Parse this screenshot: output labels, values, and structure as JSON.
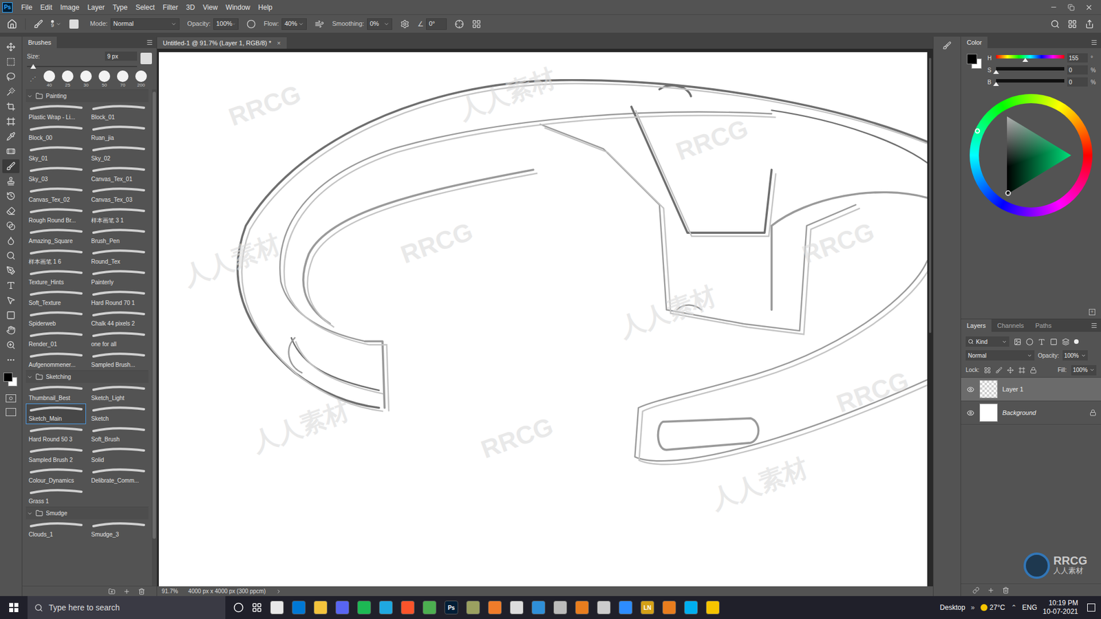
{
  "app_logo": "Ps",
  "menu": [
    "File",
    "Edit",
    "Image",
    "Layer",
    "Type",
    "Select",
    "Filter",
    "3D",
    "View",
    "Window",
    "Help"
  ],
  "options": {
    "brush_size": "9",
    "mode_label": "Mode:",
    "mode": "Normal",
    "opacity_label": "Opacity:",
    "opacity": "100%",
    "flow_label": "Flow:",
    "flow": "40%",
    "smoothing_label": "Smoothing:",
    "smoothing": "0%",
    "angle": "0°"
  },
  "document_tab": {
    "title": "Untitled-1 @ 91.7% (Layer 1, RGB/8) *",
    "close": "×"
  },
  "tools": [
    {
      "selected": false
    },
    {
      "selected": false
    },
    {
      "selected": false
    },
    {
      "selected": false
    },
    {
      "selected": false
    },
    {
      "selected": false
    },
    {
      "selected": false
    },
    {
      "selected": false
    },
    {
      "selected": true
    },
    {
      "selected": false
    },
    {
      "selected": false
    },
    {
      "selected": false
    },
    {
      "selected": false
    },
    {
      "selected": false
    },
    {
      "selected": false
    },
    {
      "selected": false
    },
    {
      "selected": false
    },
    {
      "selected": false
    },
    {
      "selected": false
    },
    {
      "selected": false
    },
    {
      "selected": false
    },
    {
      "selected": false
    }
  ],
  "brushes": {
    "title": "Brushes",
    "size_label": "Size:",
    "size": "9 px",
    "size_level": 0.03,
    "presets": [
      "40",
      "25",
      "30",
      "50",
      "70",
      "200"
    ],
    "groups": [
      {
        "name": "Painting",
        "expanded": true,
        "items": [
          {
            "label": "Plastic Wrap - Li...",
            "selected": false
          },
          {
            "label": "Block_01",
            "selected": false
          },
          {
            "label": "Block_00",
            "selected": false
          },
          {
            "label": "Ruan_jia",
            "selected": false
          },
          {
            "label": "Sky_01",
            "selected": false
          },
          {
            "label": "Sky_02",
            "selected": false
          },
          {
            "label": "Sky_03",
            "selected": false
          },
          {
            "label": "Canvas_Tex_01",
            "selected": false
          },
          {
            "label": "Canvas_Tex_02",
            "selected": false
          },
          {
            "label": "Canvas_Tex_03",
            "selected": false
          },
          {
            "label": "Rough Round Br...",
            "selected": false
          },
          {
            "label": "样本画笔 3 1",
            "selected": false
          },
          {
            "label": "Amazing_Square",
            "selected": false
          },
          {
            "label": "Brush_Pen",
            "selected": false
          },
          {
            "label": "样本画笔 1 6",
            "selected": false
          },
          {
            "label": "Round_Tex",
            "selected": false
          },
          {
            "label": "Texture_Hints",
            "selected": false
          },
          {
            "label": "Painterly",
            "selected": false
          },
          {
            "label": "Soft_Texture",
            "selected": false
          },
          {
            "label": "Hard Round 70 1",
            "selected": false
          },
          {
            "label": "Spiderweb",
            "selected": false
          },
          {
            "label": "Chalk 44 pixels 2",
            "selected": false
          },
          {
            "label": "Render_01",
            "selected": false
          },
          {
            "label": "one for all",
            "selected": false
          },
          {
            "label": "Aufgenommener...",
            "selected": false
          },
          {
            "label": "Sampled Brush...",
            "selected": false
          }
        ]
      },
      {
        "name": "Sketching",
        "expanded": true,
        "items": [
          {
            "label": "Thumbnail_Best",
            "selected": false
          },
          {
            "label": "Sketch_Light",
            "selected": false
          },
          {
            "label": "Sketch_Main",
            "selected": true
          },
          {
            "label": "Sketch",
            "selected": false
          },
          {
            "label": "Hard Round 50 3",
            "selected": false
          },
          {
            "label": "Soft_Brush",
            "selected": false
          },
          {
            "label": "Sampled Brush 2",
            "selected": false
          },
          {
            "label": "Solid",
            "selected": false
          },
          {
            "label": "Colour_Dynamics",
            "selected": false
          },
          {
            "label": "Delibrate_Comm...",
            "selected": false
          },
          {
            "label": "Grass 1",
            "selected": false
          }
        ]
      },
      {
        "name": "Smudge",
        "expanded": true,
        "items": [
          {
            "label": "Clouds_1",
            "selected": false
          },
          {
            "label": "Smudge_3",
            "selected": false
          }
        ]
      }
    ]
  },
  "status_bar": {
    "zoom": "91.7%",
    "doc_size": "4000 px x 4000 px (300 ppcm)"
  },
  "color": {
    "title": "Color",
    "foreground": "#000000",
    "background": "#ffffff",
    "channels": [
      {
        "label": "H",
        "value": "155",
        "unit": "°",
        "level": 0.43,
        "kind": "hue"
      },
      {
        "label": "S",
        "value": "0",
        "unit": "%",
        "level": 0,
        "kind": "plain"
      },
      {
        "label": "B",
        "value": "0",
        "unit": "%",
        "level": 0,
        "kind": "plain"
      }
    ]
  },
  "layers": {
    "tabs": [
      {
        "label": "Layers",
        "selected": true
      },
      {
        "label": "Channels",
        "selected": false
      },
      {
        "label": "Paths",
        "selected": false
      }
    ],
    "filter": "Kind",
    "blend_mode": "Normal",
    "opacity_label": "Opacity:",
    "opacity": "100%",
    "lock_label": "Lock:",
    "fill_label": "Fill:",
    "fill": "100%",
    "items": [
      {
        "name": "Layer 1",
        "selected": true,
        "visible": true,
        "locked": false,
        "italic": false,
        "kind": "transparent"
      },
      {
        "name": "Background",
        "selected": false,
        "visible": true,
        "locked": true,
        "italic": true,
        "kind": "white"
      }
    ]
  },
  "taskbar": {
    "search_placeholder": "Type here to search",
    "desktop": "Desktop",
    "chevron": "»",
    "weather": "27°C",
    "language": "ENG",
    "time": "10:19 PM",
    "date": "10-07-2021",
    "apps": [
      {
        "label": "",
        "color": "#e8e8e8"
      },
      {
        "label": "",
        "color": "#0078d4"
      },
      {
        "label": "",
        "color": "#f3c33c"
      },
      {
        "label": "",
        "color": "#5865f2"
      },
      {
        "label": "",
        "color": "#1db954"
      },
      {
        "label": "",
        "color": "#1fa8e0"
      },
      {
        "label": "",
        "color": "#fb542b"
      },
      {
        "label": "",
        "color": "#4caf50"
      },
      {
        "label": "Ps",
        "color": "#001e36"
      },
      {
        "label": "",
        "color": "#9aa060"
      },
      {
        "label": "",
        "color": "#f07c2a"
      },
      {
        "label": "",
        "color": "#dddddd"
      },
      {
        "label": "",
        "color": "#2f8fd8"
      },
      {
        "label": "",
        "color": "#bbbbbb"
      },
      {
        "label": "",
        "color": "#e87d1e"
      },
      {
        "label": "",
        "color": "#cccccc"
      },
      {
        "label": "",
        "color": "#2d8cff"
      },
      {
        "label": "LN",
        "color": "#d4a017"
      },
      {
        "label": "",
        "color": "#e87d1e"
      },
      {
        "label": "",
        "color": "#00aff0"
      },
      {
        "label": "",
        "color": "#f5c400"
      }
    ]
  },
  "watermarks": [
    "RRCG",
    "人人素材"
  ],
  "logo": {
    "text": "RRCG",
    "subtitle": "人人素材"
  }
}
